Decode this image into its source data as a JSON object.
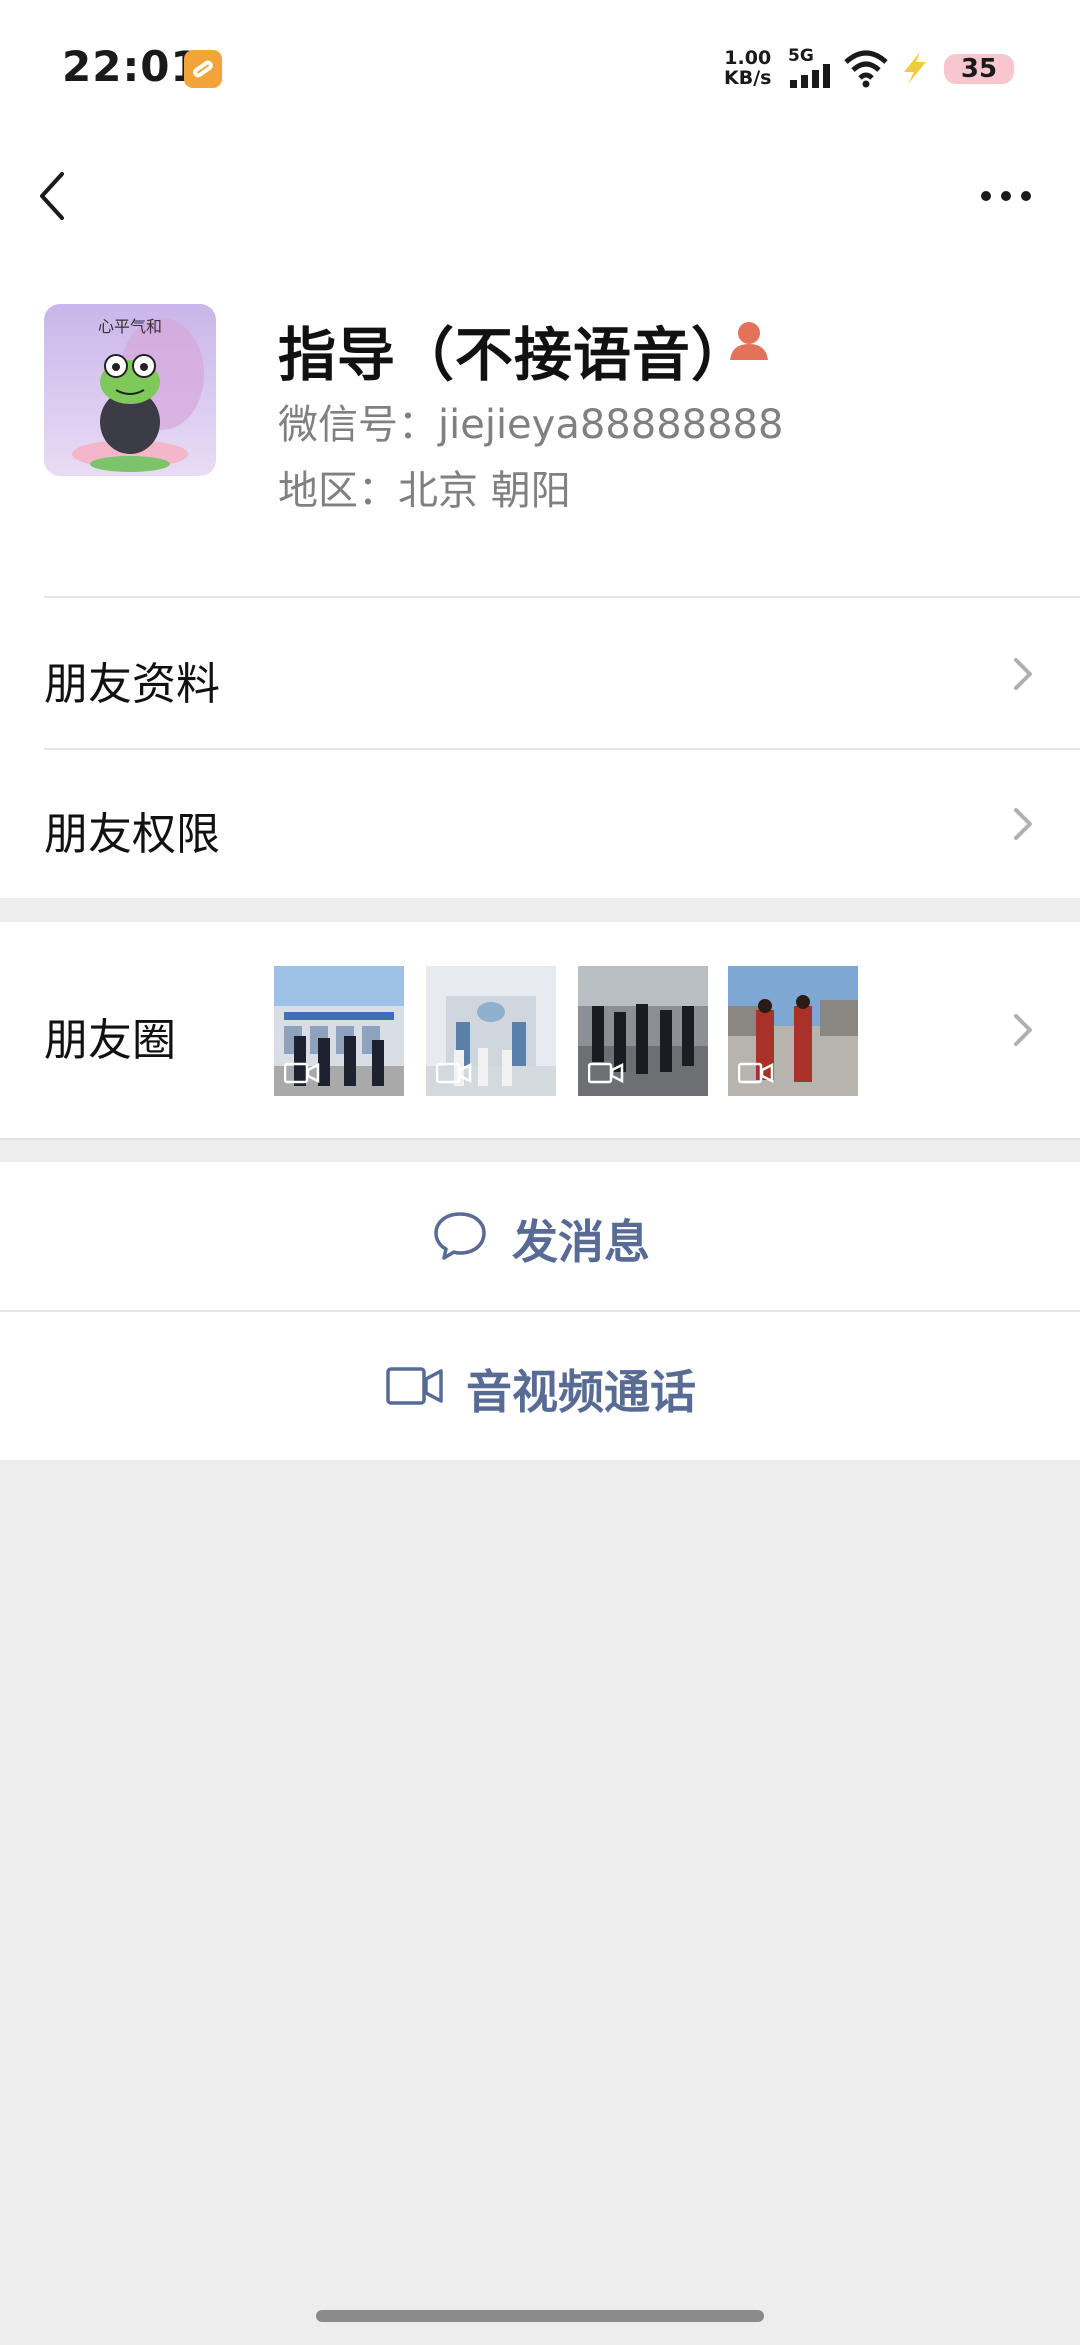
{
  "status_bar": {
    "time": "22:01",
    "net_speed_value": "1.00",
    "net_speed_unit": "KB/s",
    "network": "5G",
    "battery": "35",
    "icons": [
      "app-notification-icon",
      "signal-icon",
      "wifi-icon",
      "charging-bolt-icon"
    ]
  },
  "nav": {
    "back_icon": "chevron-left-icon",
    "more_icon": "more-dots-icon"
  },
  "profile": {
    "name": "指导（不接语音）",
    "gender_icon": "female-icon",
    "wechat_id": "微信号：jiejieya88888888",
    "region": "地区：北京  朝阳",
    "avatar_caption": "心平气和"
  },
  "menu": {
    "friend_info": "朋友资料",
    "friend_permissions": "朋友权限",
    "moments": "朋友圈"
  },
  "moments_thumbs": [
    {
      "label": "moment-video-1"
    },
    {
      "label": "moment-video-2"
    },
    {
      "label": "moment-video-3"
    },
    {
      "label": "moment-video-4"
    }
  ],
  "actions": {
    "send_message": "发消息",
    "av_call": "音视频通话"
  },
  "colors": {
    "accent": "#576b95",
    "background": "#ededed",
    "battery_bg": "#f7c6cf",
    "female_icon": "#e2735a"
  }
}
